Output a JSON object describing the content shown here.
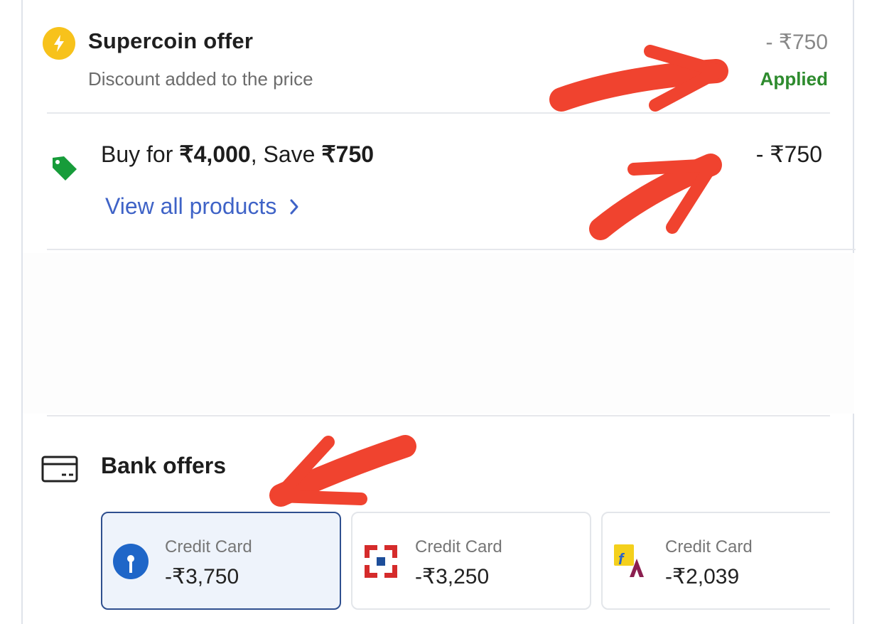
{
  "supercoin": {
    "title": "Supercoin offer",
    "subtitle": "Discount added to the price",
    "amount": "- ₹750",
    "status": "Applied",
    "icon": "lightning-coin-icon"
  },
  "combo": {
    "text_pre": "Buy for ",
    "price": "₹4,000",
    "text_mid": ", Save ",
    "save": "₹750",
    "amount": "- ₹750",
    "link_label": "View all products",
    "icon": "price-tag-icon"
  },
  "bank_offers": {
    "title": "Bank offers",
    "icon": "credit-card-icon",
    "cards": [
      {
        "label": "Credit Card",
        "value": "-₹3,750",
        "logo": "sbi-logo-icon",
        "selected": true
      },
      {
        "label": "Credit Card",
        "value": "-₹3,250",
        "logo": "hdfc-logo-icon",
        "selected": false
      },
      {
        "label": "Credit Card",
        "value": "-₹2,039",
        "logo": "flipkart-axis-logo-icon",
        "selected": false
      }
    ]
  },
  "colors": {
    "applied_green": "#2e8b2e",
    "link_blue": "#3f63c7",
    "annotation_red": "#f0432f",
    "coin_yellow": "#f7c21b"
  }
}
